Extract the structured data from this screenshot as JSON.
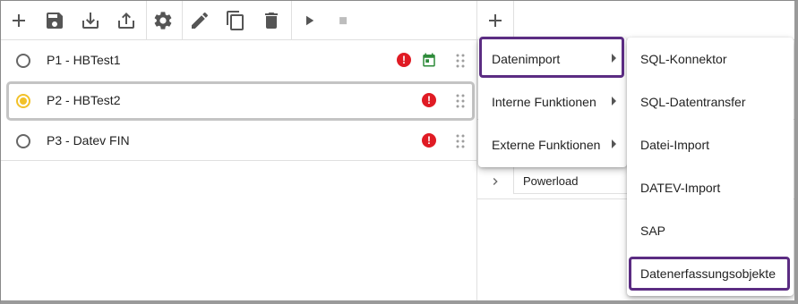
{
  "toolbar": {
    "buttons": [
      {
        "name": "add-icon"
      },
      {
        "name": "save-icon"
      },
      {
        "name": "download-icon"
      },
      {
        "name": "upload-icon"
      },
      {
        "name": "gear-icon"
      },
      {
        "name": "edit-icon"
      },
      {
        "name": "copy-icon"
      },
      {
        "name": "delete-icon"
      },
      {
        "name": "play-icon"
      },
      {
        "name": "stop-icon"
      }
    ]
  },
  "processes": [
    {
      "label": "P1 - HBTest1",
      "selected": false,
      "alert": "!",
      "scheduled": true
    },
    {
      "label": "P2 - HBTest2",
      "selected": true,
      "alert": "!",
      "scheduled": false
    },
    {
      "label": "P3 - Datev FIN",
      "selected": false,
      "alert": "!",
      "scheduled": false
    }
  ],
  "right_panel": {
    "field_value": "Powerload"
  },
  "menu_main": {
    "items": [
      {
        "label": "Datenimport",
        "has_submenu": true,
        "highlighted": true
      },
      {
        "label": "Interne Funktionen",
        "has_submenu": true
      },
      {
        "label": "Externe Funktionen",
        "has_submenu": true
      }
    ]
  },
  "menu_sub": {
    "items": [
      {
        "label": "SQL-Konnektor"
      },
      {
        "label": "SQL-Datentransfer"
      },
      {
        "label": "Datei-Import"
      },
      {
        "label": "DATEV-Import"
      },
      {
        "label": "SAP"
      },
      {
        "label": "Datenerfassungsobjekte",
        "highlighted": true
      }
    ]
  },
  "colors": {
    "highlight": "#5b2c82",
    "alert": "#e01b24",
    "calendar": "#2e8b3a",
    "radio_selected": "#f2c129"
  }
}
